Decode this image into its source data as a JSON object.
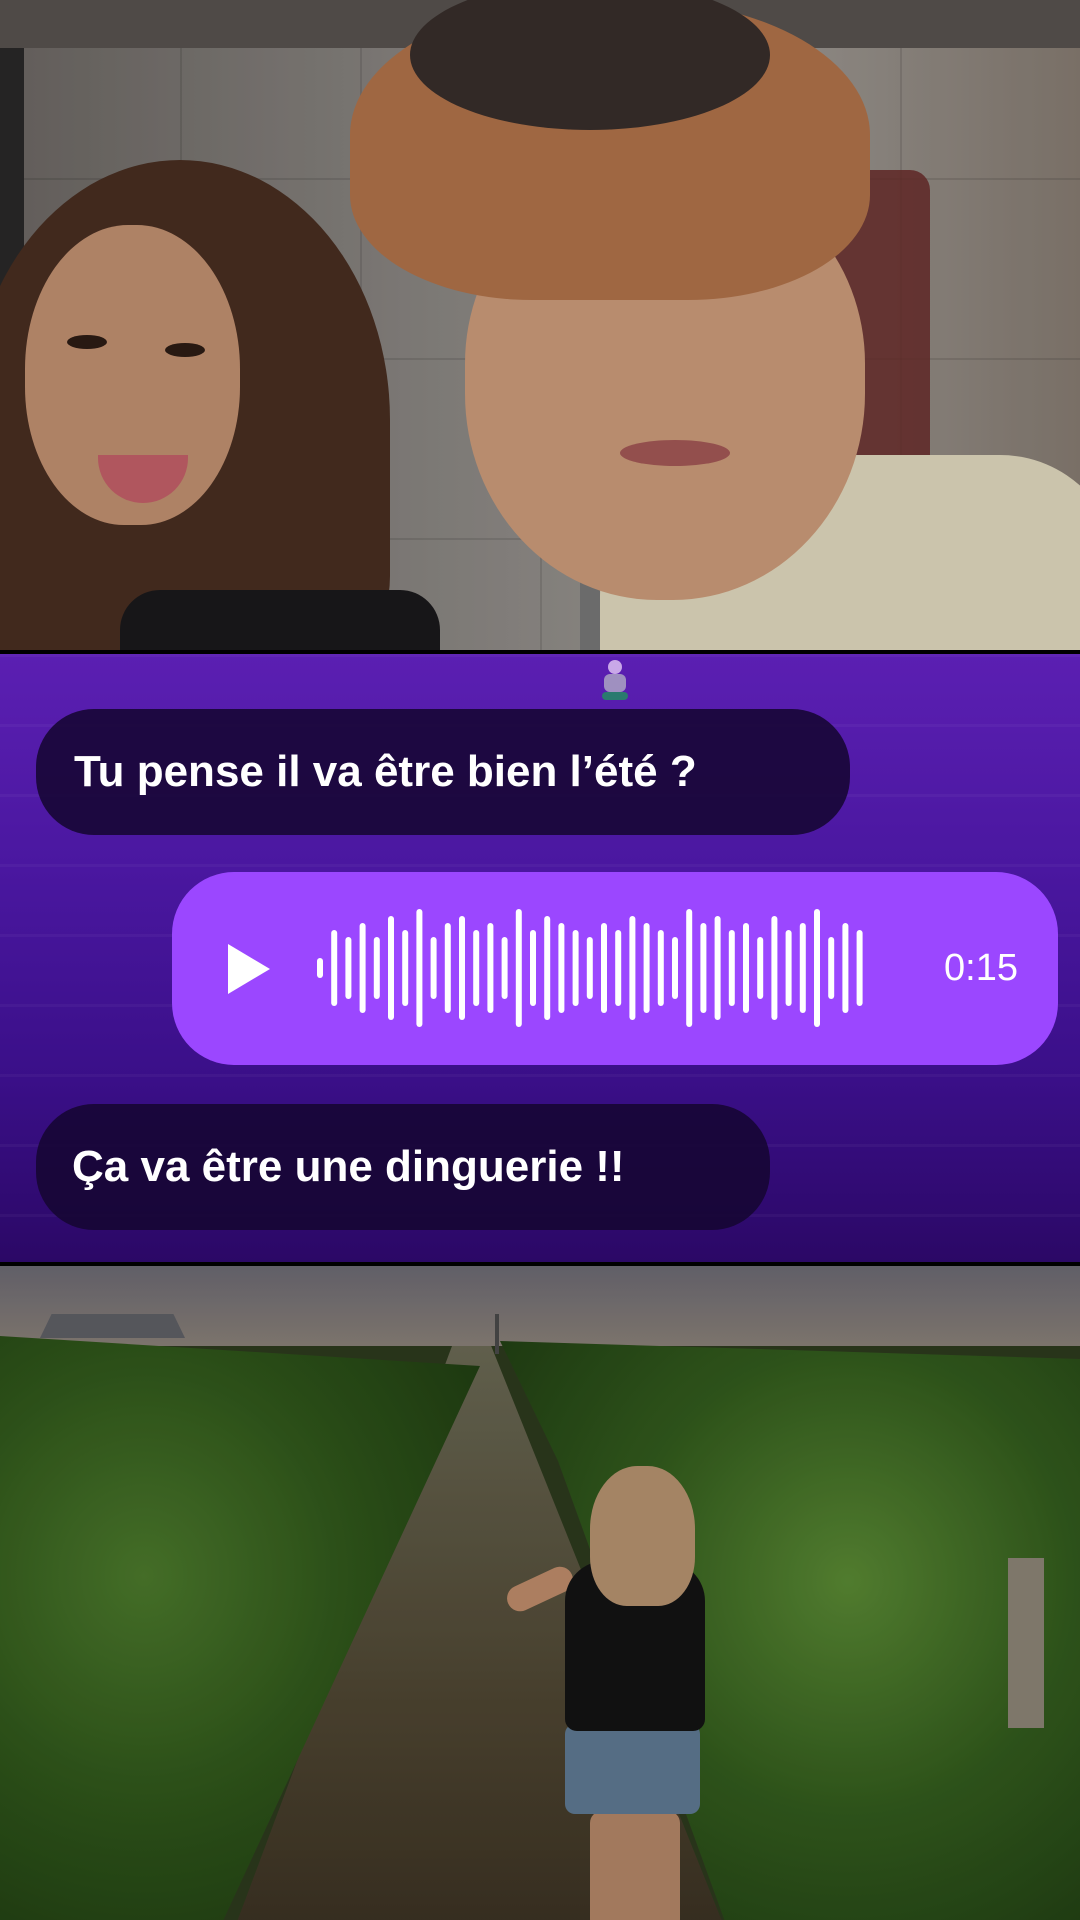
{
  "messages": [
    {
      "type": "received_text",
      "text": "Tu pense il va être bien l’été ?"
    },
    {
      "type": "sent_voice",
      "duration": "0:15",
      "waveform": [
        2,
        10,
        8,
        12,
        8,
        14,
        10,
        16,
        8,
        12,
        14,
        10,
        12,
        8,
        16,
        10,
        14,
        12,
        10,
        8,
        12,
        10,
        14,
        12,
        10,
        8,
        16,
        12,
        14,
        10,
        12,
        8,
        14,
        10,
        12,
        16,
        8,
        12,
        10
      ]
    },
    {
      "type": "received_text",
      "text": "Ça va être une dinguerie !!"
    }
  ],
  "colors": {
    "chat_background": "#4a17a0",
    "received_bubble": "#16062f",
    "voice_bubble": "#9b47ff",
    "text": "#ffffff"
  },
  "icons": {
    "play": "play-icon",
    "waveform": "waveform-icon"
  }
}
